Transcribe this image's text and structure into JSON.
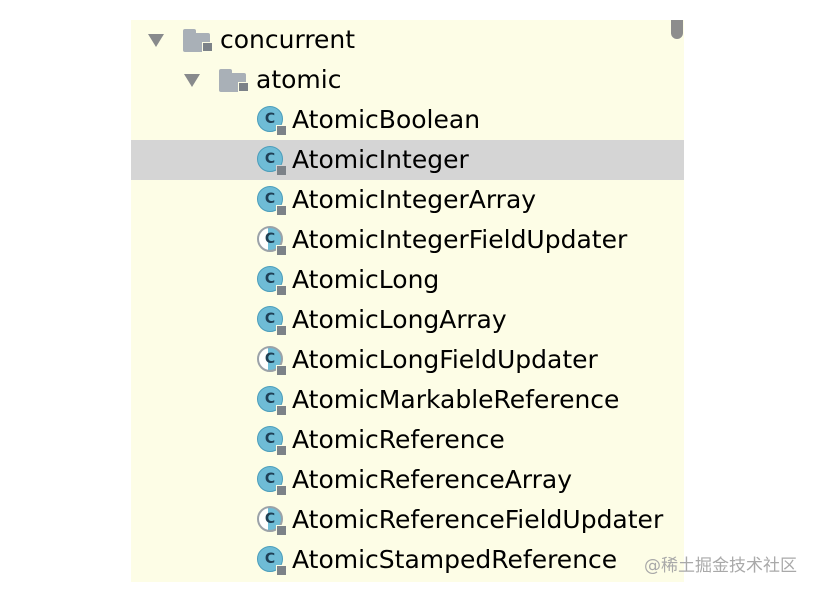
{
  "tree": {
    "packages": [
      {
        "name": "concurrent",
        "expanded": true,
        "icon": "package-folder-icon"
      },
      {
        "name": "atomic",
        "expanded": true,
        "icon": "package-folder-icon"
      }
    ],
    "classes": [
      {
        "name": "AtomicBoolean",
        "kind": "class",
        "selected": false
      },
      {
        "name": "AtomicInteger",
        "kind": "class",
        "selected": true
      },
      {
        "name": "AtomicIntegerArray",
        "kind": "class",
        "selected": false
      },
      {
        "name": "AtomicIntegerFieldUpdater",
        "kind": "abstract-class",
        "selected": false
      },
      {
        "name": "AtomicLong",
        "kind": "class",
        "selected": false
      },
      {
        "name": "AtomicLongArray",
        "kind": "class",
        "selected": false
      },
      {
        "name": "AtomicLongFieldUpdater",
        "kind": "abstract-class",
        "selected": false
      },
      {
        "name": "AtomicMarkableReference",
        "kind": "class",
        "selected": false
      },
      {
        "name": "AtomicReference",
        "kind": "class",
        "selected": false
      },
      {
        "name": "AtomicReferenceArray",
        "kind": "class",
        "selected": false
      },
      {
        "name": "AtomicReferenceFieldUpdater",
        "kind": "abstract-class",
        "selected": false
      },
      {
        "name": "AtomicStampedReference",
        "kind": "class",
        "selected": false
      }
    ],
    "class_icon_letter": "C"
  },
  "watermark": "@稀土掘金技术社区",
  "colors": {
    "panel_background": "#fdfde6",
    "selection": "#d5d5d5",
    "class_icon": "#6fbcd6",
    "folder": "#a9b0b7"
  }
}
